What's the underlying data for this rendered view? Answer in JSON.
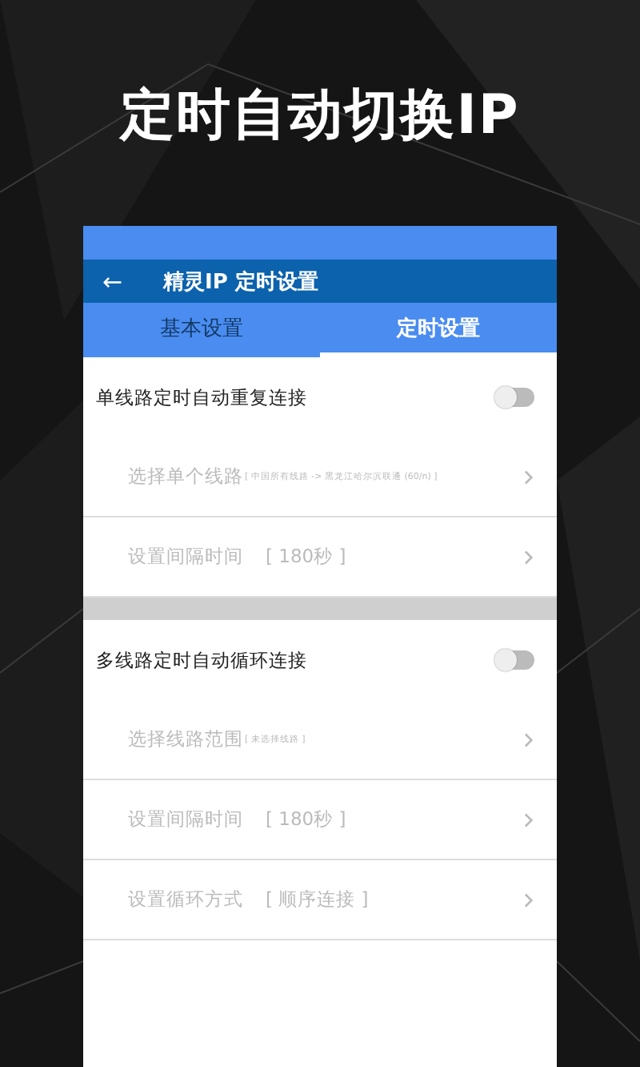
{
  "headline": "定时自动切换IP",
  "toolbar": {
    "back": "←",
    "title": "精灵IP 定时设置"
  },
  "tabs": [
    {
      "label": "基本设置",
      "selected": false
    },
    {
      "label": "定时设置",
      "selected": true
    }
  ],
  "sections": [
    {
      "title": "单线路定时自动重复连接",
      "on": false,
      "rows": [
        {
          "label": "选择单个线路",
          "value": "[ 中国所有线路 -> 黑龙江哈尔滨联通 (60/n) ]",
          "small": true,
          "disabled": true
        },
        {
          "label": "设置间隔时间",
          "value": "[ 180秒 ]",
          "small": false,
          "disabled": true
        }
      ]
    },
    {
      "title": "多线路定时自动循环连接",
      "on": false,
      "rows": [
        {
          "label": "选择线路范围",
          "value": "[ 未选择线路 ]",
          "small": true,
          "disabled": true
        },
        {
          "label": "设置间隔时间",
          "value": "[ 180秒 ]",
          "small": false,
          "disabled": true
        },
        {
          "label": "设置循环方式",
          "value": "[ 顺序连接 ]",
          "small": false,
          "disabled": true
        }
      ]
    }
  ]
}
